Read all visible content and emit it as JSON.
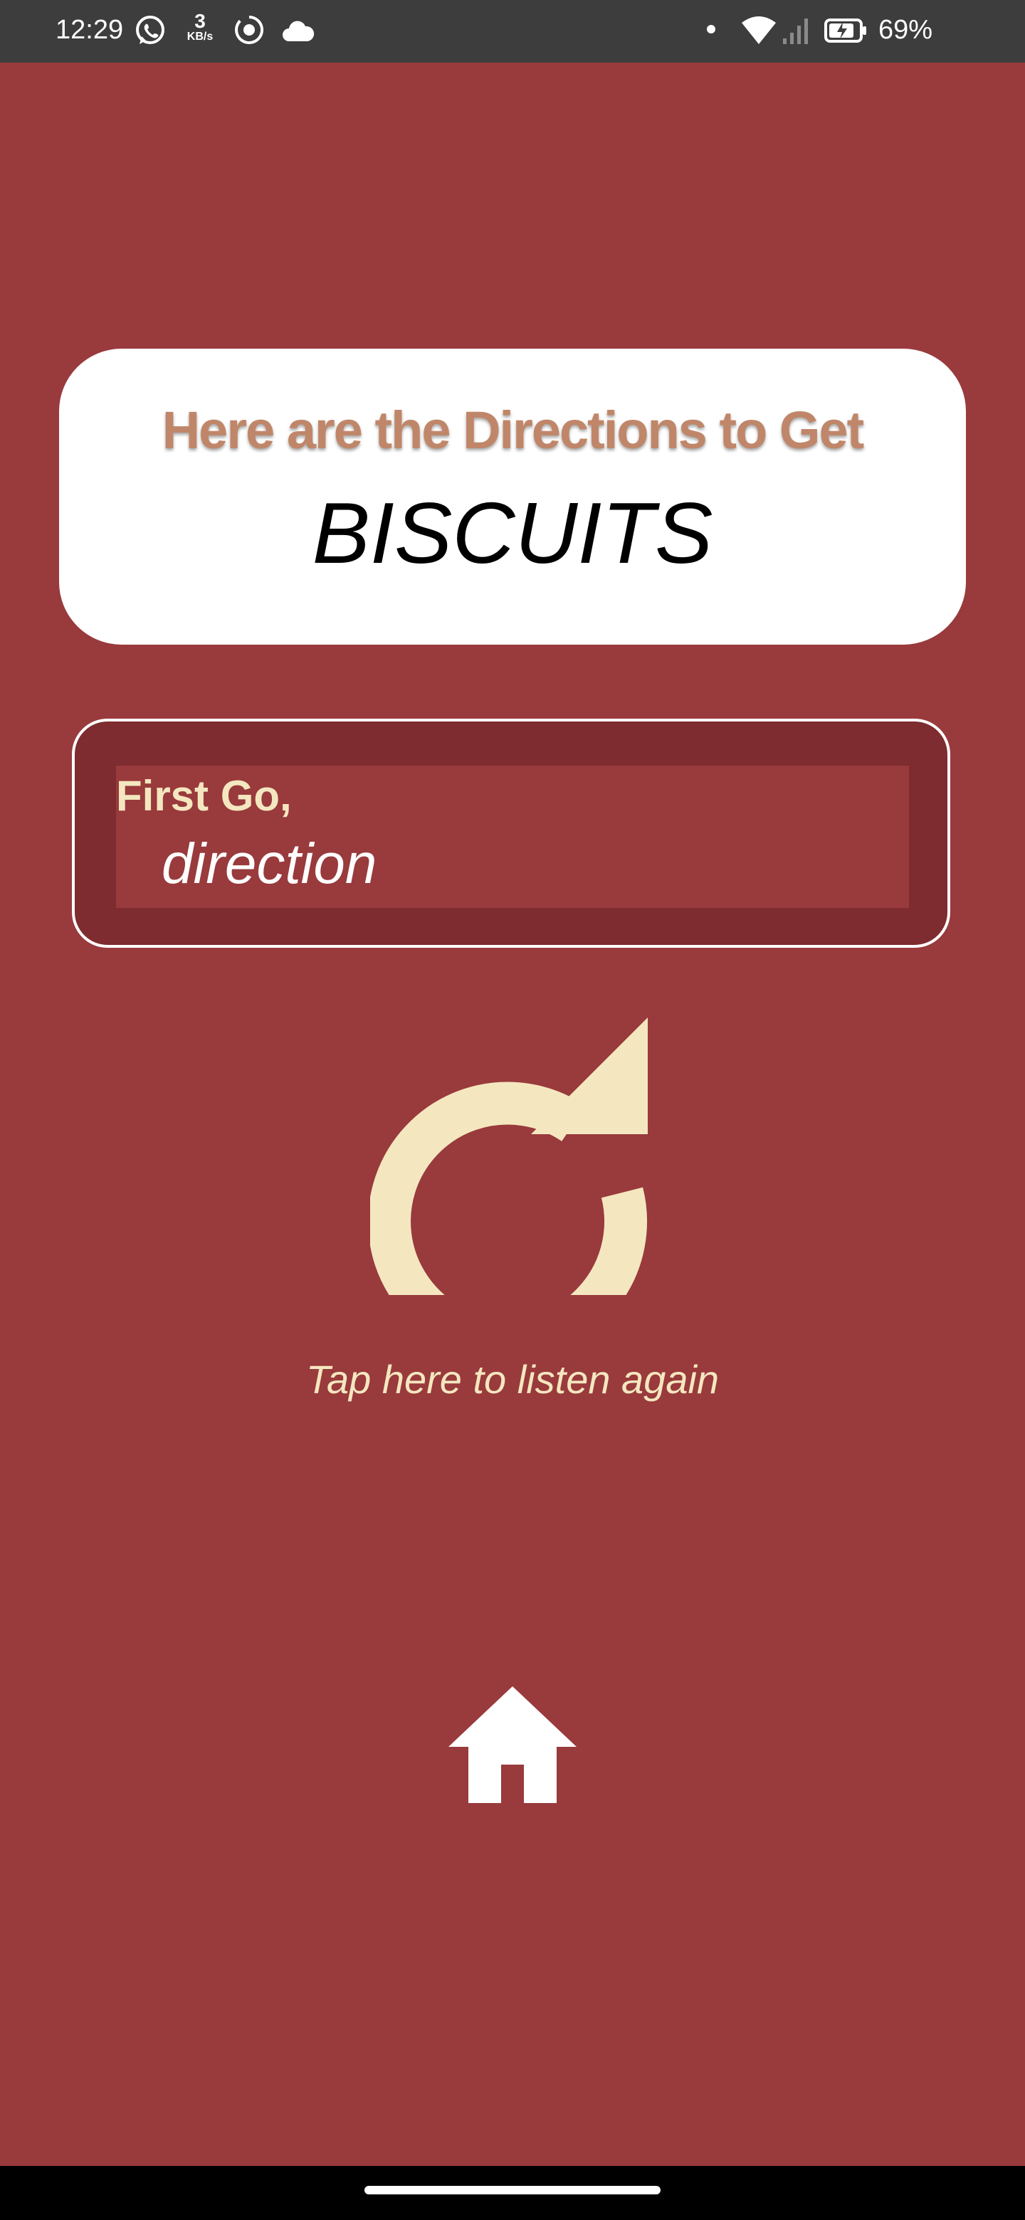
{
  "status_bar": {
    "time": "12:29",
    "net_speed_value": "3",
    "net_speed_unit": "KB/s",
    "battery_percent": "69%",
    "icons": [
      "whatsapp-icon",
      "screen-record-icon",
      "cloud-icon",
      "dot-icon",
      "wifi-icon",
      "signal-icon",
      "battery-charging-icon"
    ]
  },
  "header": {
    "title": "Here are the Directions to Get",
    "item": "BISCUITS"
  },
  "direction": {
    "step_label": "First Go,",
    "text": "direction"
  },
  "replay": {
    "icon": "replay-icon",
    "label": "Tap here to listen again"
  },
  "home": {
    "icon": "home-icon"
  },
  "colors": {
    "background": "#993a3c",
    "card_inner": "#7e2c2f",
    "accent_cream": "#f4e7c0",
    "title_tan": "#c08669"
  }
}
